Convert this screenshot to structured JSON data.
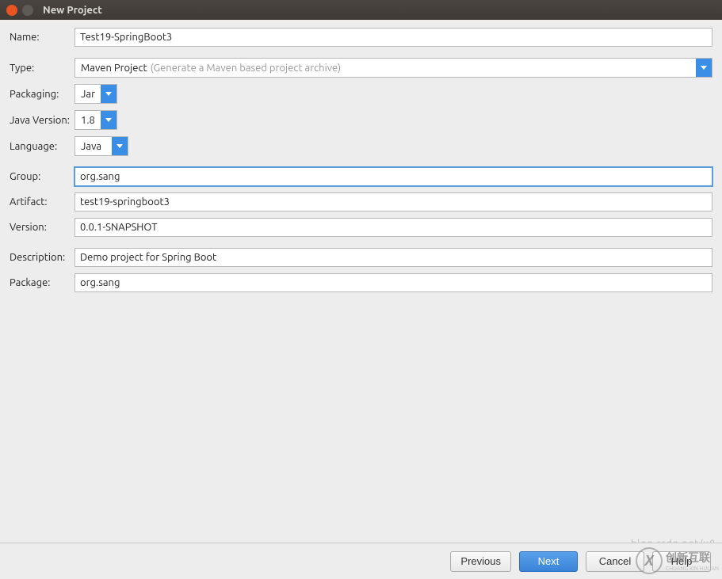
{
  "window": {
    "title": "New Project"
  },
  "form": {
    "name_label": "Name:",
    "name_value": "Test19-SpringBoot3",
    "type_label": "Type:",
    "type_value": "Maven Project",
    "type_hint": "(Generate a Maven based project archive)",
    "packaging_label": "Packaging:",
    "packaging_value": "Jar",
    "javaversion_label": "Java Version:",
    "javaversion_value": "1.8",
    "language_label": "Language:",
    "language_value": "Java",
    "group_label": "Group:",
    "group_value": "org.sang",
    "artifact_label": "Artifact:",
    "artifact_value": "test19-springboot3",
    "version_label": "Version:",
    "version_value": "0.0.1-SNAPSHOT",
    "description_label": "Description:",
    "description_value": "Demo project for Spring Boot",
    "package_label": "Package:",
    "package_value": "org.sang"
  },
  "buttons": {
    "previous": "Previous",
    "next": "Next",
    "cancel": "Cancel",
    "help": "Help"
  },
  "watermark": "blog.csdn.net/u0",
  "brand": {
    "mark": "X",
    "name": "创新互联",
    "sub": "CHUANG XIN HULIAN"
  }
}
